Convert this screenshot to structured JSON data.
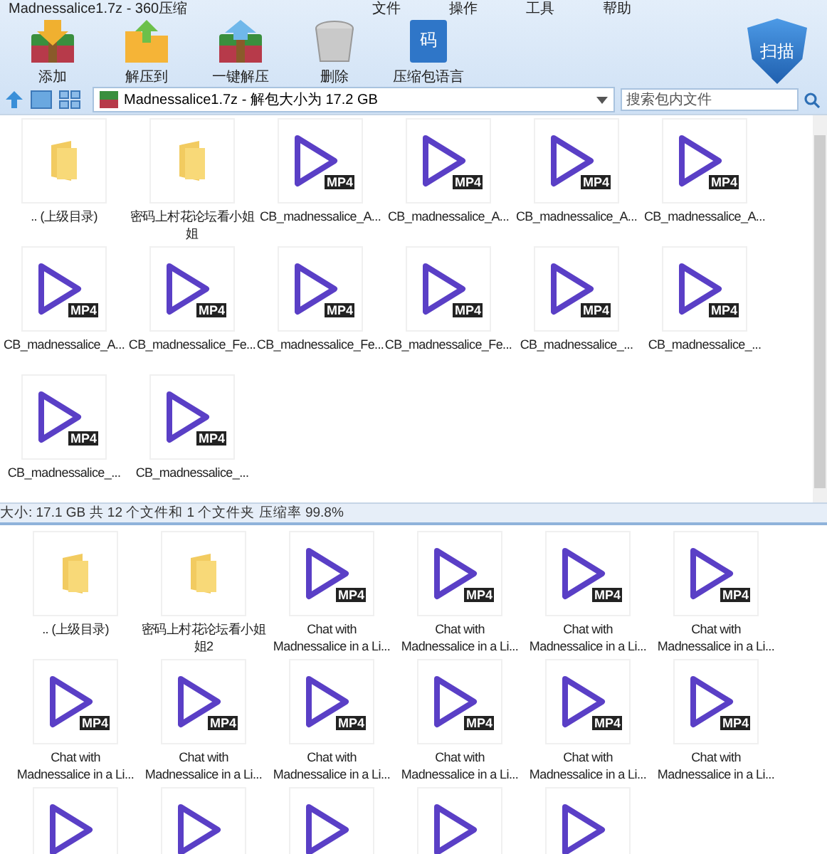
{
  "window": {
    "title": "Madnessalice1.7z - 360压缩",
    "menu": [
      "文件",
      "操作",
      "工具",
      "帮助"
    ]
  },
  "toolbar": [
    {
      "label": "添加",
      "kind": "add"
    },
    {
      "label": "解压到",
      "kind": "extract"
    },
    {
      "label": "一键解压",
      "kind": "oneclick"
    },
    {
      "label": "删除",
      "kind": "delete"
    },
    {
      "label": "压缩包语言",
      "kind": "language",
      "glyph": "码"
    }
  ],
  "scan_button": {
    "label": "扫描"
  },
  "address": {
    "value": "Madnessalice1.7z - 解包大小为 17.2 GB"
  },
  "search": {
    "placeholder": "搜索包内文件"
  },
  "files": [
    {
      "kind": "folder",
      "label": ".. (上级目录)"
    },
    {
      "kind": "folder",
      "label": "密码上村花论坛看小姐姐"
    },
    {
      "kind": "mp4",
      "badge": "MP4",
      "label": "CB_madnessalice_A..."
    },
    {
      "kind": "mp4",
      "badge": "MP4",
      "label": "CB_madnessalice_A..."
    },
    {
      "kind": "mp4",
      "badge": "MP4",
      "label": "CB_madnessalice_A..."
    },
    {
      "kind": "mp4",
      "badge": "MP4",
      "label": "CB_madnessalice_A..."
    },
    {
      "kind": "mp4",
      "badge": "MP4",
      "label": "CB_madnessalice_A..."
    },
    {
      "kind": "mp4",
      "badge": "MP4",
      "label": "CB_madnessalice_Fe..."
    },
    {
      "kind": "mp4",
      "badge": "MP4",
      "label": "CB_madnessalice_Fe..."
    },
    {
      "kind": "mp4",
      "badge": "MP4",
      "label": "CB_madnessalice_Fe..."
    },
    {
      "kind": "mp4",
      "badge": "MP4",
      "label": "CB_madnessalice_..."
    },
    {
      "kind": "mp4",
      "badge": "MP4",
      "label": "CB_madnessalice_..."
    },
    {
      "kind": "mp4",
      "badge": "MP4",
      "label": "CB_madnessalice_..."
    },
    {
      "kind": "mp4",
      "badge": "MP4",
      "label": "CB_madnessalice_..."
    }
  ],
  "status_bar": "大小: 17.1 GB 共 12 个文件和 1 个文件夹 压缩率 99.8%",
  "second_window": {
    "files": [
      {
        "kind": "folder",
        "label": ".. (上级目录)"
      },
      {
        "kind": "folder",
        "label": "密码上村花论坛看小姐姐2"
      },
      {
        "kind": "mp4",
        "badge": "MP4",
        "label": "Chat with\nMadnessalice in a Li..."
      },
      {
        "kind": "mp4",
        "badge": "MP4",
        "label": "Chat with\nMadnessalice in a Li..."
      },
      {
        "kind": "mp4",
        "badge": "MP4",
        "label": "Chat with\nMadnessalice in a Li..."
      },
      {
        "kind": "mp4",
        "badge": "MP4",
        "label": "Chat with\nMadnessalice in a Li..."
      },
      {
        "kind": "mp4",
        "badge": "MP4",
        "label": "Chat with\nMadnessalice in a Li..."
      },
      {
        "kind": "mp4",
        "badge": "MP4",
        "label": "Chat with\nMadnessalice in a Li..."
      },
      {
        "kind": "mp4",
        "badge": "MP4",
        "label": "Chat with\nMadnessalice in a Li..."
      },
      {
        "kind": "mp4",
        "badge": "MP4",
        "label": "Chat with\nMadnessalice in a Li..."
      },
      {
        "kind": "mp4",
        "badge": "MP4",
        "label": "Chat with\nMadnessalice in a Li..."
      },
      {
        "kind": "mp4",
        "badge": "MP4",
        "label": "Chat with\nMadnessalice in a Li..."
      },
      {
        "kind": "mp4"
      },
      {
        "kind": "mp4"
      },
      {
        "kind": "mp4"
      },
      {
        "kind": "mp4"
      },
      {
        "kind": "mp4"
      }
    ]
  }
}
